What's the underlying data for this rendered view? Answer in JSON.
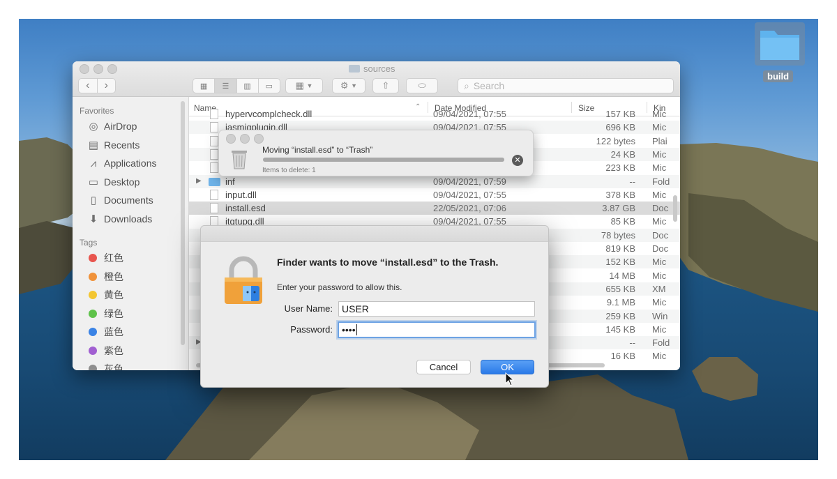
{
  "desktop": {
    "folder_label": "build"
  },
  "finder": {
    "title": "sources",
    "search_placeholder": "Search",
    "columns": {
      "name": "Name",
      "date": "Date Modified",
      "size": "Size",
      "kind": "Kin"
    },
    "sidebar": {
      "favorites_header": "Favorites",
      "favorites": [
        {
          "label": "AirDrop",
          "icon": "airdrop-icon"
        },
        {
          "label": "Recents",
          "icon": "clock-icon"
        },
        {
          "label": "Applications",
          "icon": "applications-icon"
        },
        {
          "label": "Desktop",
          "icon": "desktop-icon"
        },
        {
          "label": "Documents",
          "icon": "document-icon"
        },
        {
          "label": "Downloads",
          "icon": "download-icon"
        }
      ],
      "tags_header": "Tags",
      "tags": [
        {
          "label": "红色",
          "color": "#e8554e"
        },
        {
          "label": "橙色",
          "color": "#f0923a"
        },
        {
          "label": "黄色",
          "color": "#f3c632"
        },
        {
          "label": "绿色",
          "color": "#5ec24a"
        },
        {
          "label": "蓝色",
          "color": "#3a83e5"
        },
        {
          "label": "紫色",
          "color": "#a15fd1"
        },
        {
          "label": "灰色",
          "color": "#8e8e8e"
        }
      ]
    },
    "rows": [
      {
        "name": "hypervcomplcheck.dll",
        "date": "09/04/2021, 07:55",
        "size": "157 KB",
        "kind": "Mic"
      },
      {
        "name": "iasmigplugin.dll",
        "date": "09/04/2021, 07:55",
        "size": "696 KB",
        "kind": "Mic"
      },
      {
        "name": "",
        "date": "",
        "size": "122 bytes",
        "kind": "Plai"
      },
      {
        "name": "",
        "date": "",
        "size": "24 KB",
        "kind": "Mic"
      },
      {
        "name": "",
        "date": "",
        "size": "223 KB",
        "kind": "Mic"
      },
      {
        "name": "inf",
        "date": "09/04/2021, 07:59",
        "size": "--",
        "kind": "Fold"
      },
      {
        "name": "input.dll",
        "date": "09/04/2021, 07:55",
        "size": "378 KB",
        "kind": "Mic"
      },
      {
        "name": "install.esd",
        "date": "22/05/2021, 07:06",
        "size": "3.87 GB",
        "kind": "Doc"
      },
      {
        "name": "itgtupg.dll",
        "date": "09/04/2021, 07:55",
        "size": "85 KB",
        "kind": "Mic"
      },
      {
        "name": "",
        "date": "",
        "size": "78 bytes",
        "kind": "Doc"
      },
      {
        "name": "",
        "date": "",
        "size": "819 KB",
        "kind": "Doc"
      },
      {
        "name": "",
        "date": "",
        "size": "152 KB",
        "kind": "Mic"
      },
      {
        "name": "",
        "date": "",
        "size": "14 MB",
        "kind": "Mic"
      },
      {
        "name": "",
        "date": "",
        "size": "655 KB",
        "kind": "XM"
      },
      {
        "name": "",
        "date": "",
        "size": "9.1 MB",
        "kind": "Mic"
      },
      {
        "name": "",
        "date": "",
        "size": "259 KB",
        "kind": "Win"
      },
      {
        "name": "",
        "date": "",
        "size": "145 KB",
        "kind": "Mic"
      },
      {
        "name": "",
        "date": "",
        "size": "--",
        "kind": "Fold"
      },
      {
        "name": "",
        "date": "",
        "size": "16 KB",
        "kind": "Mic"
      }
    ]
  },
  "moving_dialog": {
    "title": "Moving “install.esd” to “Trash”",
    "subtitle": "Items to delete: 1",
    "progress": 1.0
  },
  "auth_dialog": {
    "title": "Finder wants to move “install.esd” to the Trash.",
    "message": "Enter your password to allow this.",
    "username_label": "User Name:",
    "username_value": "USER",
    "password_label": "Password:",
    "password_value": "••••",
    "cancel_label": "Cancel",
    "ok_label": "OK"
  }
}
